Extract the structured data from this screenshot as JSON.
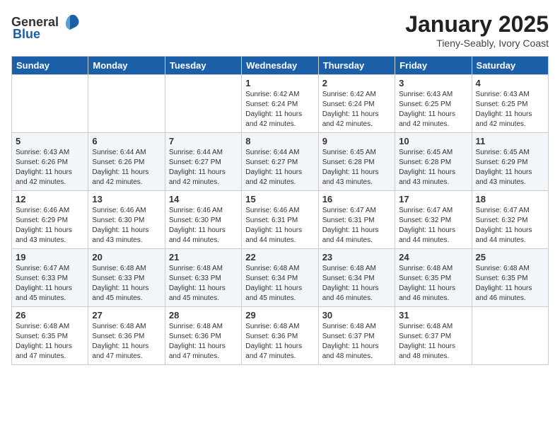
{
  "header": {
    "logo_general": "General",
    "logo_blue": "Blue",
    "month": "January 2025",
    "location": "Tieny-Seably, Ivory Coast"
  },
  "days_of_week": [
    "Sunday",
    "Monday",
    "Tuesday",
    "Wednesday",
    "Thursday",
    "Friday",
    "Saturday"
  ],
  "weeks": [
    [
      {
        "day": "",
        "info": ""
      },
      {
        "day": "",
        "info": ""
      },
      {
        "day": "",
        "info": ""
      },
      {
        "day": "1",
        "info": "Sunrise: 6:42 AM\nSunset: 6:24 PM\nDaylight: 11 hours\nand 42 minutes."
      },
      {
        "day": "2",
        "info": "Sunrise: 6:42 AM\nSunset: 6:24 PM\nDaylight: 11 hours\nand 42 minutes."
      },
      {
        "day": "3",
        "info": "Sunrise: 6:43 AM\nSunset: 6:25 PM\nDaylight: 11 hours\nand 42 minutes."
      },
      {
        "day": "4",
        "info": "Sunrise: 6:43 AM\nSunset: 6:25 PM\nDaylight: 11 hours\nand 42 minutes."
      }
    ],
    [
      {
        "day": "5",
        "info": "Sunrise: 6:43 AM\nSunset: 6:26 PM\nDaylight: 11 hours\nand 42 minutes."
      },
      {
        "day": "6",
        "info": "Sunrise: 6:44 AM\nSunset: 6:26 PM\nDaylight: 11 hours\nand 42 minutes."
      },
      {
        "day": "7",
        "info": "Sunrise: 6:44 AM\nSunset: 6:27 PM\nDaylight: 11 hours\nand 42 minutes."
      },
      {
        "day": "8",
        "info": "Sunrise: 6:44 AM\nSunset: 6:27 PM\nDaylight: 11 hours\nand 42 minutes."
      },
      {
        "day": "9",
        "info": "Sunrise: 6:45 AM\nSunset: 6:28 PM\nDaylight: 11 hours\nand 43 minutes."
      },
      {
        "day": "10",
        "info": "Sunrise: 6:45 AM\nSunset: 6:28 PM\nDaylight: 11 hours\nand 43 minutes."
      },
      {
        "day": "11",
        "info": "Sunrise: 6:45 AM\nSunset: 6:29 PM\nDaylight: 11 hours\nand 43 minutes."
      }
    ],
    [
      {
        "day": "12",
        "info": "Sunrise: 6:46 AM\nSunset: 6:29 PM\nDaylight: 11 hours\nand 43 minutes."
      },
      {
        "day": "13",
        "info": "Sunrise: 6:46 AM\nSunset: 6:30 PM\nDaylight: 11 hours\nand 43 minutes."
      },
      {
        "day": "14",
        "info": "Sunrise: 6:46 AM\nSunset: 6:30 PM\nDaylight: 11 hours\nand 44 minutes."
      },
      {
        "day": "15",
        "info": "Sunrise: 6:46 AM\nSunset: 6:31 PM\nDaylight: 11 hours\nand 44 minutes."
      },
      {
        "day": "16",
        "info": "Sunrise: 6:47 AM\nSunset: 6:31 PM\nDaylight: 11 hours\nand 44 minutes."
      },
      {
        "day": "17",
        "info": "Sunrise: 6:47 AM\nSunset: 6:32 PM\nDaylight: 11 hours\nand 44 minutes."
      },
      {
        "day": "18",
        "info": "Sunrise: 6:47 AM\nSunset: 6:32 PM\nDaylight: 11 hours\nand 44 minutes."
      }
    ],
    [
      {
        "day": "19",
        "info": "Sunrise: 6:47 AM\nSunset: 6:33 PM\nDaylight: 11 hours\nand 45 minutes."
      },
      {
        "day": "20",
        "info": "Sunrise: 6:48 AM\nSunset: 6:33 PM\nDaylight: 11 hours\nand 45 minutes."
      },
      {
        "day": "21",
        "info": "Sunrise: 6:48 AM\nSunset: 6:33 PM\nDaylight: 11 hours\nand 45 minutes."
      },
      {
        "day": "22",
        "info": "Sunrise: 6:48 AM\nSunset: 6:34 PM\nDaylight: 11 hours\nand 45 minutes."
      },
      {
        "day": "23",
        "info": "Sunrise: 6:48 AM\nSunset: 6:34 PM\nDaylight: 11 hours\nand 46 minutes."
      },
      {
        "day": "24",
        "info": "Sunrise: 6:48 AM\nSunset: 6:35 PM\nDaylight: 11 hours\nand 46 minutes."
      },
      {
        "day": "25",
        "info": "Sunrise: 6:48 AM\nSunset: 6:35 PM\nDaylight: 11 hours\nand 46 minutes."
      }
    ],
    [
      {
        "day": "26",
        "info": "Sunrise: 6:48 AM\nSunset: 6:35 PM\nDaylight: 11 hours\nand 47 minutes."
      },
      {
        "day": "27",
        "info": "Sunrise: 6:48 AM\nSunset: 6:36 PM\nDaylight: 11 hours\nand 47 minutes."
      },
      {
        "day": "28",
        "info": "Sunrise: 6:48 AM\nSunset: 6:36 PM\nDaylight: 11 hours\nand 47 minutes."
      },
      {
        "day": "29",
        "info": "Sunrise: 6:48 AM\nSunset: 6:36 PM\nDaylight: 11 hours\nand 47 minutes."
      },
      {
        "day": "30",
        "info": "Sunrise: 6:48 AM\nSunset: 6:37 PM\nDaylight: 11 hours\nand 48 minutes."
      },
      {
        "day": "31",
        "info": "Sunrise: 6:48 AM\nSunset: 6:37 PM\nDaylight: 11 hours\nand 48 minutes."
      },
      {
        "day": "",
        "info": ""
      }
    ]
  ]
}
